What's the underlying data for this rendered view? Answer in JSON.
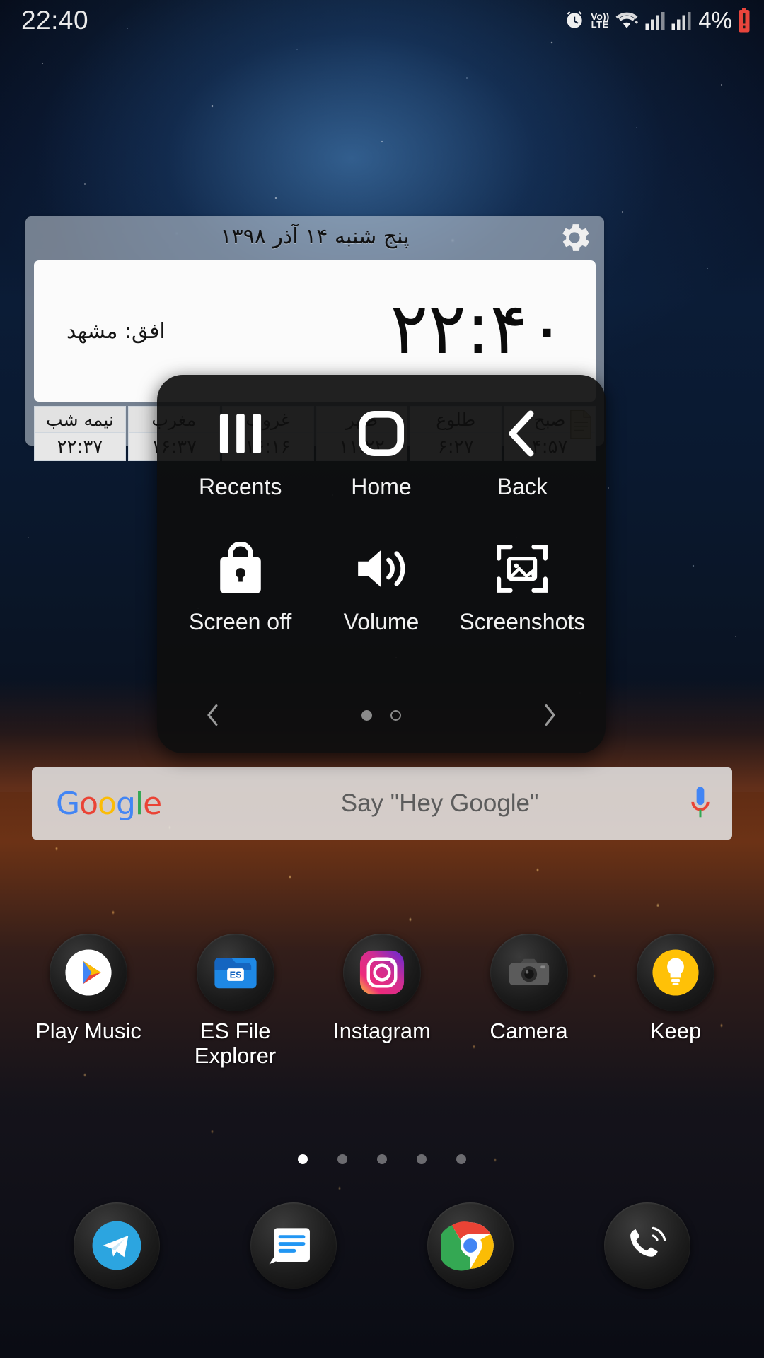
{
  "status_bar": {
    "time": "22:40",
    "battery_percent": "4%",
    "network_label": "Vo))",
    "network_sub": "LTE",
    "icons": [
      "alarm-icon",
      "volte-icon",
      "wifi-icon",
      "signal-bars-icon",
      "signal-bars-2-icon",
      "battery-icon"
    ]
  },
  "calendar_widget": {
    "date": "پنج شنبه ۱۴  آذر ۱۳۹۸",
    "clock": "۲۲:۴۰",
    "city_label": "افق: مشهد",
    "settings_icon": "gear-icon",
    "doc_icon": "document-icon",
    "prayer_times": [
      {
        "name": "صبح",
        "time": "۴:۵۷"
      },
      {
        "name": "طلوع",
        "time": "۶:۲۷"
      },
      {
        "name": "ظهر",
        "time": "۱۱:۲۲"
      },
      {
        "name": "غروب",
        "time": "۱۶:۱۶"
      },
      {
        "name": "مغرب",
        "time": "۱۶:۳۷"
      },
      {
        "name": "نیمه شب",
        "time": "۲۲:۳۷"
      }
    ]
  },
  "search": {
    "logo_letters": [
      "G",
      "o",
      "o",
      "g",
      "l",
      "e"
    ],
    "placeholder": "Say \"Hey Google\"",
    "mic_icon": "microphone-icon"
  },
  "assistive_menu": {
    "row1": [
      {
        "label": "Recents",
        "icon": "recents-icon"
      },
      {
        "label": "Home",
        "icon": "home-icon"
      },
      {
        "label": "Back",
        "icon": "back-icon"
      }
    ],
    "row2": [
      {
        "label": "Screen off",
        "icon": "lock-icon"
      },
      {
        "label": "Volume",
        "icon": "volume-icon"
      },
      {
        "label": "Screenshots",
        "icon": "screenshot-icon"
      }
    ],
    "pager": {
      "left_arrow": "chevron-left-icon",
      "right_arrow": "chevron-right-icon",
      "dots": [
        "filled",
        "hollow"
      ]
    }
  },
  "apps": [
    {
      "label": "Play Music",
      "icon": "play-music-icon"
    },
    {
      "label": "ES File\nExplorer",
      "icon": "es-file-explorer-icon"
    },
    {
      "label": "Instagram",
      "icon": "instagram-icon"
    },
    {
      "label": "Camera",
      "icon": "camera-icon"
    },
    {
      "label": "Keep",
      "icon": "keep-icon"
    }
  ],
  "page_indicator": {
    "dots": [
      "on",
      "off",
      "off",
      "off",
      "off"
    ]
  },
  "dock": [
    {
      "icon": "telegram-icon"
    },
    {
      "icon": "messages-icon"
    },
    {
      "icon": "chrome-icon"
    },
    {
      "icon": "phone-icon"
    }
  ],
  "colors": {
    "accent_blue": "#4285F4",
    "accent_red": "#EA4335",
    "accent_yellow": "#FBBC05",
    "accent_green": "#34A853",
    "battery_low": "#e8453c",
    "menu_bg": "#0e0e0e"
  }
}
